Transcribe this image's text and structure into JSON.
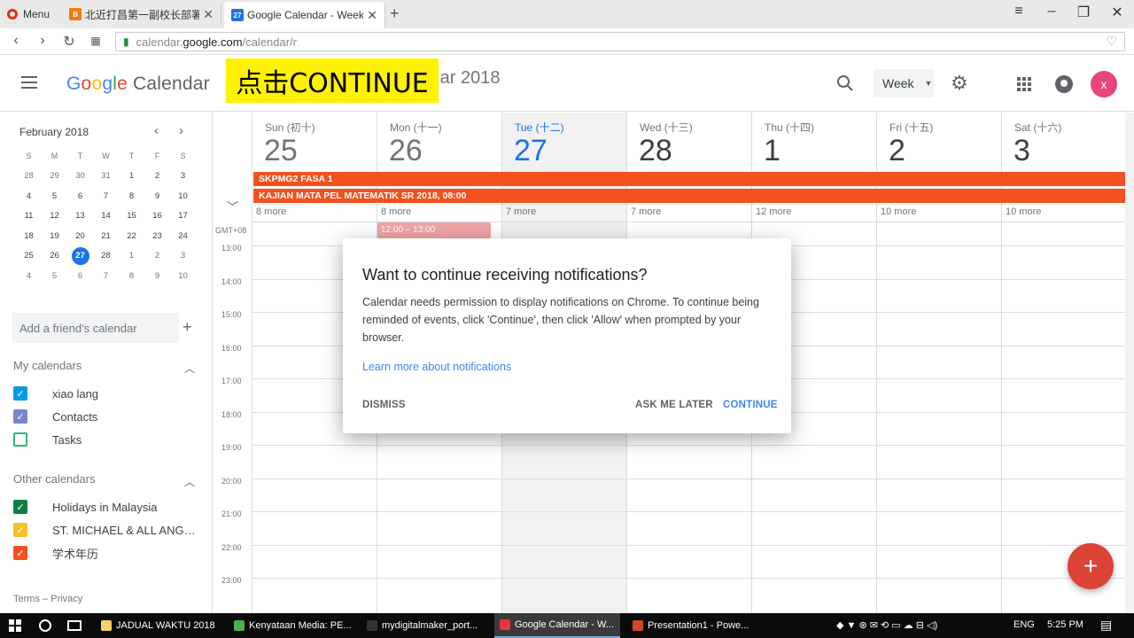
{
  "browser": {
    "menu_label": "Menu",
    "tabs": [
      {
        "title": "北近打昌第一副校长部署"
      },
      {
        "title": "Google Calendar - Week o",
        "icon_text": "27"
      }
    ],
    "url_prefix": "calendar.",
    "url_host": "google.com",
    "url_path": "/calendar/r"
  },
  "header": {
    "logo_letters": [
      "G",
      "o",
      "o",
      "g",
      "l",
      "e"
    ],
    "app_name": "Calendar",
    "date_range": "Mar 2018",
    "overlay_text": "点击CONTINUE",
    "view_select": "Week",
    "avatar_letter": "x",
    "colors": {
      "accent": "#1a73e8",
      "avatar": "#e8457a",
      "overlay": "#fff200"
    }
  },
  "mini_calendar": {
    "title": "February 2018",
    "prev_icon": "‹",
    "next_icon": "›",
    "weekdays": [
      "S",
      "M",
      "T",
      "W",
      "T",
      "F",
      "S"
    ],
    "weeks": [
      [
        "28",
        "29",
        "30",
        "31",
        "1",
        "2",
        "3"
      ],
      [
        "4",
        "5",
        "6",
        "7",
        "8",
        "9",
        "10"
      ],
      [
        "11",
        "12",
        "13",
        "14",
        "15",
        "16",
        "17"
      ],
      [
        "18",
        "19",
        "20",
        "21",
        "22",
        "23",
        "24"
      ],
      [
        "25",
        "26",
        "27",
        "28",
        "1",
        "2",
        "3"
      ],
      [
        "4",
        "5",
        "6",
        "7",
        "8",
        "9",
        "10"
      ]
    ],
    "today": "27"
  },
  "sidebar": {
    "add_friend_placeholder": "Add a friend's calendar",
    "my_calendars_title": "My calendars",
    "my_calendars": [
      {
        "name": "xiao lang",
        "color": "#039be5",
        "checked": true
      },
      {
        "name": "Contacts",
        "color": "#7986cb",
        "checked": true
      },
      {
        "name": "Tasks",
        "color": "#33b679",
        "checked": false
      }
    ],
    "other_calendars_title": "Other calendars",
    "other_calendars": [
      {
        "name": "Holidays in Malaysia",
        "color": "#0b8043",
        "checked": true
      },
      {
        "name": "ST. MICHAEL & ALL ANGELS",
        "color": "#f6bf26",
        "checked": true
      },
      {
        "name": "学术年历",
        "color": "#f4511e",
        "checked": true
      }
    ],
    "terms": "Terms – Privacy"
  },
  "week": {
    "days": [
      {
        "name": "Sun (初十)",
        "num": "25",
        "more": "8 more"
      },
      {
        "name": "Mon (十一)",
        "num": "26",
        "more": "8 more"
      },
      {
        "name": "Tue (十二)",
        "num": "27",
        "more": "7 more"
      },
      {
        "name": "Wed (十三)",
        "num": "28",
        "more": "7 more"
      },
      {
        "name": "Thu (十四)",
        "num": "1",
        "more": "12 more"
      },
      {
        "name": "Fri (十五)",
        "num": "2",
        "more": "10 more"
      },
      {
        "name": "Sat (十六)",
        "num": "3",
        "more": "10 more"
      }
    ],
    "allday_events": [
      {
        "title": "SKPMG2 FASA 1",
        "color": "#f4511e"
      },
      {
        "title": "KAJIAN MATA PEL MATEMATIK SR 2018, 08:00",
        "color": "#f4511e"
      }
    ],
    "timezone": "GMT+08",
    "hours": [
      "13:00",
      "14:00",
      "15:00",
      "16:00",
      "17:00",
      "18:00",
      "19:00",
      "20:00",
      "21:00",
      "22:00",
      "23:00"
    ],
    "event": {
      "time": "12:00 – 13:00"
    }
  },
  "dialog": {
    "title": "Want to continue receiving notifications?",
    "body": "Calendar needs permission to display notifications on Chrome. To continue being reminded of events, click 'Continue', then click 'Allow' when prompted by your browser.",
    "learn_more": "Learn more about notifications",
    "dismiss": "DISMISS",
    "ask_later": "ASK ME LATER",
    "continue": "CONTINUE"
  },
  "taskbar": {
    "items": [
      {
        "label": "JADUAL WAKTU 2018",
        "color": "#f5d36b"
      },
      {
        "label": "Kenyataan Media: PE...",
        "color": "#4caf50"
      },
      {
        "label": "mydigitalmaker_port...",
        "color": "#333333"
      },
      {
        "label": "Google Calendar - W...",
        "color": "#e53935"
      },
      {
        "label": "Presentation1 - Powe...",
        "color": "#d24726"
      }
    ],
    "lang": "ENG",
    "time": "5:25 PM"
  }
}
